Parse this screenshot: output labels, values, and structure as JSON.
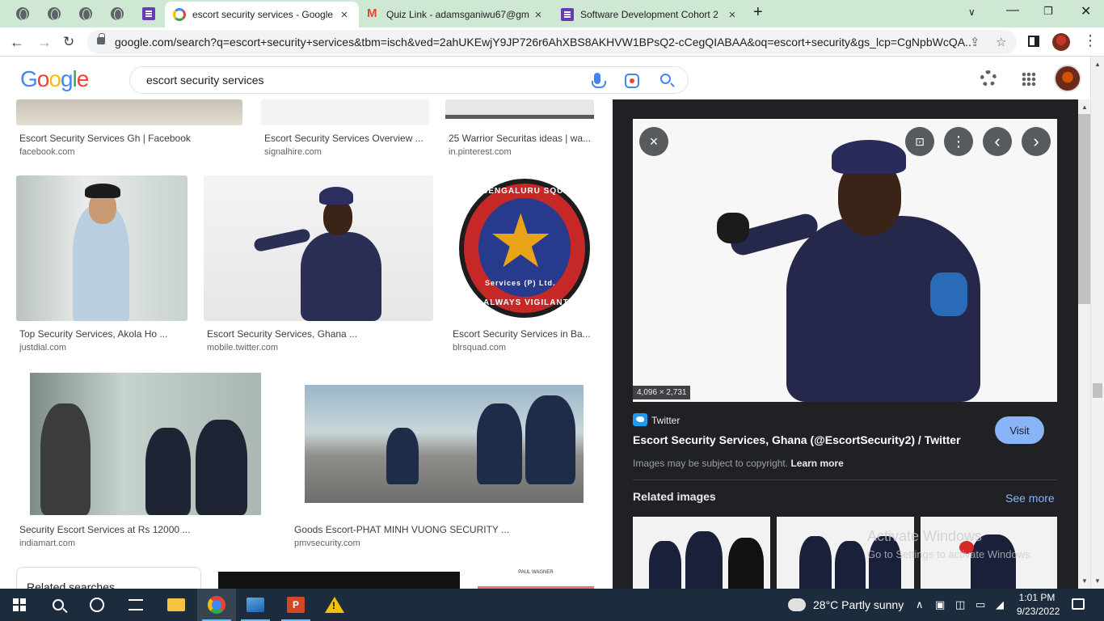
{
  "browser": {
    "tabs": [
      {
        "title": "escort security services - Google",
        "active": true
      },
      {
        "title": "Quiz Link - adamsganiwu67@gm",
        "active": false
      },
      {
        "title": "Software Development Cohort 2",
        "active": false
      }
    ],
    "url": "google.com/search?q=escort+security+services&tbm=isch&ved=2ahUKEwjY9JP726r6AhXBS8AKHVW1BPsQ2-cCegQIABAA&oq=escort+security&gs_lcp=CgNpbWcQA..."
  },
  "google": {
    "logo": [
      "G",
      "o",
      "o",
      "g",
      "l",
      "e"
    ],
    "query": "escort security services"
  },
  "results": [
    {
      "caption": "Escort Security Services Gh | Facebook",
      "source": "facebook.com"
    },
    {
      "caption": "Escort Security Services Overview ...",
      "source": "signalhire.com"
    },
    {
      "caption": "25 Warrior Securitas ideas | wa...",
      "source": "in.pinterest.com"
    },
    {
      "caption": "Top Security Services, Akola Ho ...",
      "source": "justdial.com"
    },
    {
      "caption": "Escort Security Services, Ghana ...",
      "source": "mobile.twitter.com"
    },
    {
      "caption": "Escort Security Services in Ba...",
      "source": "blrsquad.com"
    },
    {
      "caption": "Security Escort Services at Rs 12000 ...",
      "source": "indiamart.com"
    },
    {
      "caption": "Goods Escort-PHAT MINH VUONG SECURITY ...",
      "source": "pmvsecurity.com"
    }
  ],
  "badge": {
    "top": "BENGALURU SQUAD",
    "middle": "Services (P) Ltd.",
    "bottom": "ALWAYS VIGILANT"
  },
  "related_searches_label": "Related searches",
  "partial_card_text": "PAUL WAGNER",
  "panel": {
    "dimensions": "4,096 × 2,731",
    "site": "Twitter",
    "title": "Escort Security Services, Ghana (@EscortSecurity2) / Twitter",
    "visit_label": "Visit",
    "copyright": "Images may be subject to copyright.",
    "learn_more": "Learn more",
    "related_heading": "Related images",
    "see_more": "See more",
    "watermark_title": "Activate Windows",
    "watermark_sub": "Go to Settings to activate Windows."
  },
  "taskbar": {
    "weather": "28°C  Partly sunny",
    "time": "1:01 PM",
    "date": "9/23/2022",
    "ppt_letter": "P",
    "warn_mark": "!"
  },
  "icons": {
    "back": "arrow-left",
    "forward": "arrow-right",
    "reload": "reload",
    "close": "×",
    "prev": "‹",
    "next": "›",
    "more": "⋮"
  },
  "colors": {
    "tabstrip": "#cfe8d3",
    "panel_bg": "#202124",
    "link_blue": "#8ab4f8",
    "taskbar": "#1c2c3c"
  }
}
